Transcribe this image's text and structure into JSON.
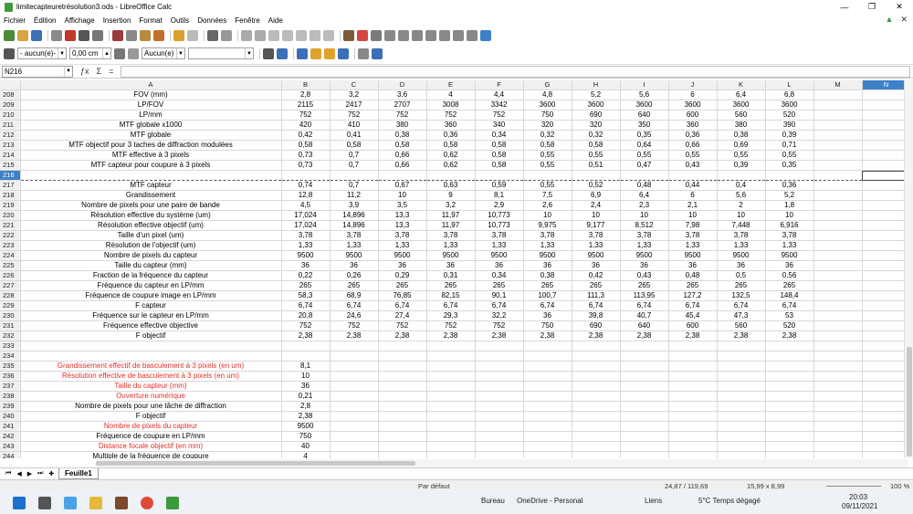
{
  "window": {
    "title": "limitecapteuretrésolution3.ods - LibreOffice Calc",
    "min": "—",
    "max": "❐",
    "close": "✕"
  },
  "menu": [
    "Fichier",
    "Édition",
    "Affichage",
    "Insertion",
    "Format",
    "Outils",
    "Données",
    "Fenêtre",
    "Aide"
  ],
  "toolbar2": {
    "line_style": "- aucun(e)-",
    "line_width": "0,00 cm",
    "area_style": "Aucun(e)"
  },
  "formula": {
    "cell_ref": "N216",
    "value": ""
  },
  "columns": [
    "A",
    "B",
    "C",
    "D",
    "E",
    "F",
    "G",
    "H",
    "I",
    "J",
    "K",
    "L",
    "M",
    "N"
  ],
  "rows": [
    {
      "n": "208",
      "a": "FOV (mm)",
      "v": [
        "2,8",
        "3,2",
        "3,6",
        "4",
        "4,4",
        "4,8",
        "5,2",
        "5,6",
        "6",
        "6,4",
        "6,8"
      ]
    },
    {
      "n": "209",
      "a": "LP/FOV",
      "v": [
        "2115",
        "2417",
        "2707",
        "3008",
        "3342",
        "3600",
        "3600",
        "3600",
        "3600",
        "3600",
        "3600"
      ]
    },
    {
      "n": "210",
      "a": "LP/mm",
      "v": [
        "752",
        "752",
        "752",
        "752",
        "752",
        "750",
        "690",
        "640",
        "600",
        "560",
        "520"
      ]
    },
    {
      "n": "211",
      "a": "MTF globale x1000",
      "v": [
        "420",
        "410",
        "380",
        "360",
        "340",
        "320",
        "320",
        "350",
        "360",
        "380",
        "390"
      ]
    },
    {
      "n": "212",
      "a": "MTF globale",
      "v": [
        "0,42",
        "0,41",
        "0,38",
        "0,36",
        "0,34",
        "0,32",
        "0,32",
        "0,35",
        "0,36",
        "0,38",
        "0,39"
      ]
    },
    {
      "n": "213",
      "a": "MTF objectif pour 3 taches de diffraction modulées",
      "v": [
        "0,58",
        "0,58",
        "0,58",
        "0,58",
        "0,58",
        "0,58",
        "0,58",
        "0,64",
        "0,66",
        "0,69",
        "0,71"
      ]
    },
    {
      "n": "214",
      "a": "MTF effective à 3 pixels",
      "v": [
        "0,73",
        "0,7",
        "0,66",
        "0,62",
        "0,58",
        "0,55",
        "0,55",
        "0,55",
        "0,55",
        "0,55",
        "0,55"
      ]
    },
    {
      "n": "215",
      "a": "MTF capteur pour coupure à 3 pixels",
      "v": [
        "0,73",
        "0,7",
        "0,66",
        "0,62",
        "0,58",
        "0,55",
        "0,51",
        "0,47",
        "0,43",
        "0,39",
        "0,35"
      ]
    },
    {
      "n": "216",
      "a": "",
      "v": [
        "",
        "",
        "",
        "",
        "",
        "",
        "",
        "",
        "",
        "",
        ""
      ]
    },
    {
      "n": "217",
      "a": "MTF capteur",
      "v": [
        "0,74",
        "0,7",
        "0,67",
        "0,63",
        "0,59",
        "0,55",
        "0,52",
        "0,48",
        "0,44",
        "0,4",
        "0,36"
      ]
    },
    {
      "n": "218",
      "a": "Grandissement",
      "v": [
        "12,8",
        "11,2",
        "10",
        "9",
        "8,1",
        "7,5",
        "6,9",
        "6,4",
        "6",
        "5,6",
        "5,2"
      ]
    },
    {
      "n": "219",
      "a": "Nombre de pixels pour une paire de bande",
      "v": [
        "4,5",
        "3,9",
        "3,5",
        "3,2",
        "2,9",
        "2,6",
        "2,4",
        "2,3",
        "2,1",
        "2",
        "1,8"
      ]
    },
    {
      "n": "220",
      "a": "Résolution effective du système (um)",
      "v": [
        "17,024",
        "14,896",
        "13,3",
        "11,97",
        "10,773",
        "10",
        "10",
        "10",
        "10",
        "10",
        "10"
      ]
    },
    {
      "n": "221",
      "a": "Résolution effective objectif (um)",
      "v": [
        "17,024",
        "14,896",
        "13,3",
        "11,97",
        "10,773",
        "9,975",
        "9,177",
        "8,512",
        "7,98",
        "7,448",
        "6,916"
      ]
    },
    {
      "n": "222",
      "a": "Taille d'un pixel (um)",
      "v": [
        "3,78",
        "3,78",
        "3,78",
        "3,78",
        "3,78",
        "3,78",
        "3,78",
        "3,78",
        "3,78",
        "3,78",
        "3,78"
      ]
    },
    {
      "n": "223",
      "a": "Résolution de l'objectif (um)",
      "v": [
        "1,33",
        "1,33",
        "1,33",
        "1,33",
        "1,33",
        "1,33",
        "1,33",
        "1,33",
        "1,33",
        "1,33",
        "1,33"
      ]
    },
    {
      "n": "224",
      "a": "Nombre de pixels du capteur",
      "v": [
        "9500",
        "9500",
        "9500",
        "9500",
        "9500",
        "9500",
        "9500",
        "9500",
        "9500",
        "9500",
        "9500"
      ]
    },
    {
      "n": "225",
      "a": "Taille du capteur (mm)",
      "v": [
        "36",
        "36",
        "36",
        "36",
        "36",
        "36",
        "36",
        "36",
        "36",
        "36",
        "36"
      ]
    },
    {
      "n": "226",
      "a": "Fraction de la fréquence du capteur",
      "v": [
        "0,22",
        "0,26",
        "0,29",
        "0,31",
        "0,34",
        "0,38",
        "0,42",
        "0,43",
        "0,48",
        "0,5",
        "0,56"
      ]
    },
    {
      "n": "227",
      "a": "Fréquence du capteur en LP/mm",
      "v": [
        "265",
        "265",
        "265",
        "265",
        "265",
        "265",
        "265",
        "265",
        "265",
        "265",
        "265"
      ]
    },
    {
      "n": "228",
      "a": "Fréquence de coupure image en LP/mm",
      "v": [
        "58,3",
        "68,9",
        "76,85",
        "82,15",
        "90,1",
        "100,7",
        "111,3",
        "113,95",
        "127,2",
        "132,5",
        "148,4"
      ]
    },
    {
      "n": "229",
      "a": "F capteur",
      "v": [
        "6,74",
        "6,74",
        "6,74",
        "6,74",
        "6,74",
        "6,74",
        "6,74",
        "6,74",
        "6,74",
        "6,74",
        "6,74"
      ]
    },
    {
      "n": "230",
      "a": "Fréquence sur le capteur en LP/mm",
      "v": [
        "20,8",
        "24,6",
        "27,4",
        "29,3",
        "32,2",
        "36",
        "39,8",
        "40,7",
        "45,4",
        "47,3",
        "53"
      ]
    },
    {
      "n": "231",
      "a": "Fréquence effective objective",
      "v": [
        "752",
        "752",
        "752",
        "752",
        "752",
        "750",
        "690",
        "640",
        "600",
        "560",
        "520"
      ]
    },
    {
      "n": "232",
      "a": "F objectif",
      "v": [
        "2,38",
        "2,38",
        "2,38",
        "2,38",
        "2,38",
        "2,38",
        "2,38",
        "2,38",
        "2,38",
        "2,38",
        "2,38"
      ]
    },
    {
      "n": "233",
      "a": "",
      "v": [
        "",
        "",
        "",
        "",
        "",
        "",
        "",
        "",
        "",
        "",
        ""
      ]
    },
    {
      "n": "234",
      "a": "",
      "v": [
        "",
        "",
        "",
        "",
        "",
        "",
        "",
        "",
        "",
        "",
        ""
      ]
    },
    {
      "n": "235",
      "a": "Grandissement effectif de basculement à 3 pixels (en um)",
      "red": true,
      "v": [
        "8,1"
      ]
    },
    {
      "n": "236",
      "a": "Résolution effective de basculement à 3 pixels (en um)",
      "red": true,
      "v": [
        "10"
      ]
    },
    {
      "n": "237",
      "a": "Taille du capteur (mm)",
      "red": true,
      "v": [
        "36"
      ]
    },
    {
      "n": "238",
      "a": "Ouverture numérique",
      "red": true,
      "v": [
        "0,21"
      ]
    },
    {
      "n": "239",
      "a": "Nombre de pixels pour une tâche de diffraction",
      "v": [
        "2,8"
      ]
    },
    {
      "n": "240",
      "a": "F objectif",
      "v": [
        "2,38"
      ]
    },
    {
      "n": "241",
      "a": "Nombre de pixels du capteur",
      "red": true,
      "v": [
        "9500"
      ]
    },
    {
      "n": "242",
      "a": "Fréquence de coupure en LP/mm",
      "v": [
        "750"
      ]
    },
    {
      "n": "243",
      "a": "Distance focale objectif (en mm)",
      "red": true,
      "v": [
        "40"
      ]
    },
    {
      "n": "244",
      "a": "Multiple de la fréquence de coupure",
      "v": [
        "4"
      ]
    }
  ],
  "sheet_tab": "Feuille1",
  "status": {
    "style": "Par défaut",
    "position": "24,87 / 119,69",
    "size": "15,99 x 8,99",
    "zoom": "100 %"
  },
  "taskbar": {
    "bureau": "Bureau",
    "onedrive": "OneDrive - Personal",
    "liens": "Liens",
    "weather": "5°C  Temps dégagé",
    "time": "20:03",
    "date": "09/11/2021"
  }
}
